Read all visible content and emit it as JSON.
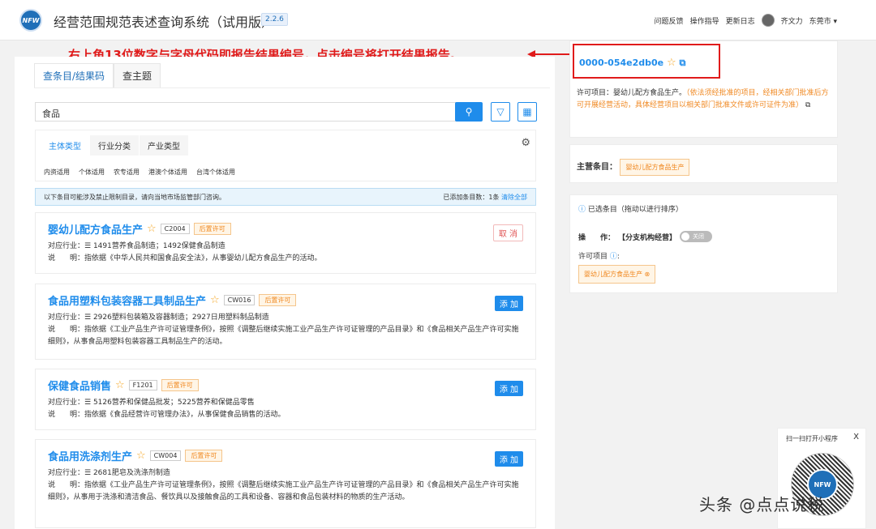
{
  "header": {
    "logo": "NFW",
    "title": "经营范围规范表述查询系统（试用版）",
    "version": "2.2.6",
    "nav": [
      "问题反馈",
      "操作指导",
      "更新日志"
    ],
    "user": "齐文力",
    "region": "东莞市 ▾"
  },
  "annotation": {
    "text": "右上角13位数字与字母代码即报告结果编号，点击编号将打开结果报告。"
  },
  "left": {
    "tabs": [
      "查条目/结果码",
      "查主题"
    ],
    "search": {
      "value": "食品",
      "search_icon": "search-icon",
      "filter_icon": "filter-icon",
      "grid_icon": "grid-icon"
    },
    "filter_tabs": [
      "主体类型",
      "行业分类",
      "产业类型"
    ],
    "filter_subs": [
      "内资适用",
      "个体适用",
      "农专适用",
      "港澳个体适用",
      "台湾个体适用"
    ],
    "info": {
      "text": "以下条目可能涉及禁止限制目录，请向当地市场监管部门咨询。",
      "added": "已添加条目数：1条",
      "clear": "清除全部"
    },
    "items": [
      {
        "title": "婴幼儿配方食品生产",
        "code": "C2004",
        "badge": "后置许可",
        "action": "取 消",
        "industry_label": "对应行业：",
        "industry": "☰ 1491营养食品制造；1492保健食品制造",
        "desc_label": "说　　明：",
        "desc": "指依据《中华人民共和国食品安全法》，从事婴幼儿配方食品生产的活动。"
      },
      {
        "title": "食品用塑料包装容器工具制品生产",
        "code": "CW016",
        "badge": "后置许可",
        "action": "添 加",
        "industry_label": "对应行业：",
        "industry": "☰ 2926塑料包装箱及容器制造；2927日用塑料制品制造",
        "desc_label": "说　　明：",
        "desc": "指依据《工业产品生产许可证管理条例》，按照《调整后继续实施工业产品生产许可证管理的产品目录》和《食品相关产品生产许可实施细则》，从事食品用塑料包装容器工具制品生产的活动。"
      },
      {
        "title": "保健食品销售",
        "code": "F1201",
        "badge": "后置许可",
        "action": "添 加",
        "industry_label": "对应行业：",
        "industry": "☰ 5126营养和保健品批发；5225营养和保健品零售",
        "desc_label": "说　　明：",
        "desc": "指依据《食品经营许可管理办法》，从事保健食品销售的活动。"
      },
      {
        "title": "食品用洗涤剂生产",
        "code": "CW004",
        "badge": "后置许可",
        "action": "添 加",
        "industry_label": "对应行业：",
        "industry": "☰ 2681肥皂及洗涤剂制造",
        "desc_label": "说　　明：",
        "desc": "指依据《工业产品生产许可证管理条例》，按照《调整后继续实施工业产品生产许可证管理的产品目录》和《食品相关产品生产许可实施细则》，从事用于洗涤和清洁食品、餐饮具以及接触食品的工具和设备、容器和食品包装材料的物质的生产活动。"
      }
    ]
  },
  "right": {
    "result_code": "0000-054e2db0e",
    "perm_label": "许可项目：婴幼儿配方食品生产。",
    "perm_note": "（依法须经批准的项目，经相关部门批准后方可开展经营活动，具体经营项目以相关部门批准文件或许可证件为准）",
    "main_label": "主营条目：",
    "main_value": "婴幼儿配方食品生产",
    "selected_title": "已选条目（拖动以进行排序）",
    "op_label": "操　　作：",
    "op_value": "【分支机构经营】",
    "toggle": "关闭",
    "perm_items_label": "许可项目",
    "perm_tag": "婴幼儿配方食品生产 ⊗"
  },
  "qr": {
    "title": "扫一扫打开小程序",
    "close": "X",
    "logo": "NFW"
  },
  "watermark": "头条 @点点说税"
}
